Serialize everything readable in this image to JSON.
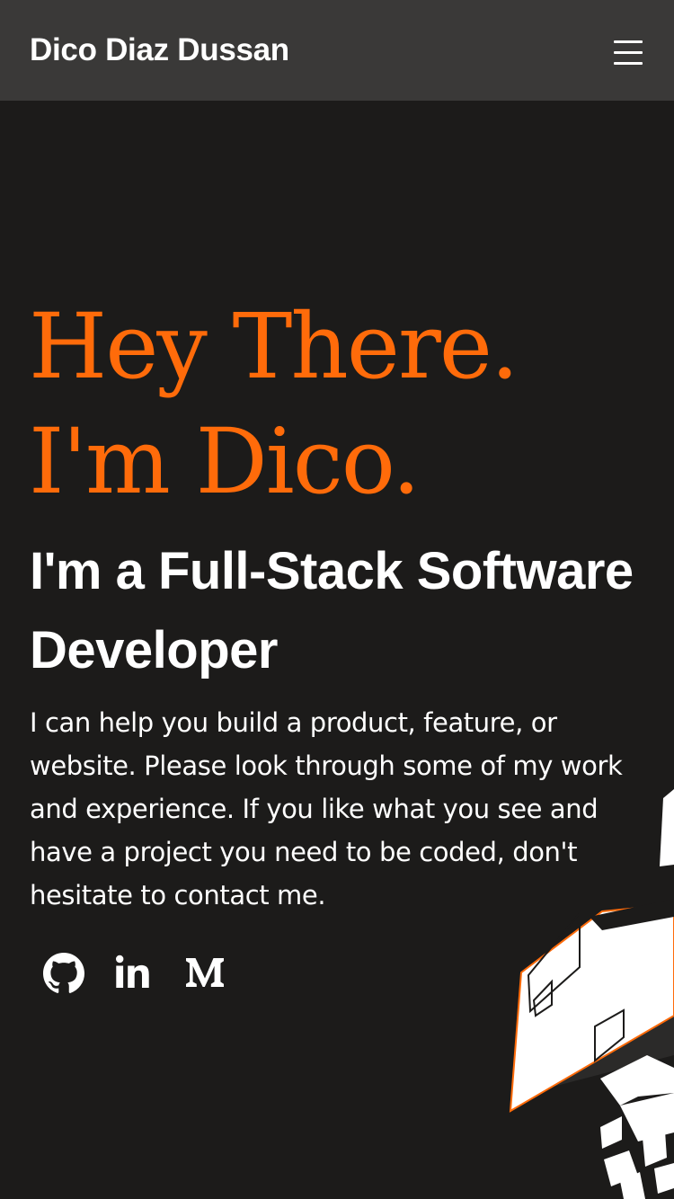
{
  "header": {
    "brand": "Dico Diaz Dussan",
    "menu_icon": "hamburger-menu-icon"
  },
  "hero": {
    "greeting": "Hey There. I'm Dico.",
    "role": "I'm a Full-Stack Software Developer",
    "description": "I can help you build a product, feature, or website. Please look through some of my work and experience. If you like what you see and have a project you need to be coded, don't hesitate to contact me."
  },
  "social": {
    "icons": [
      "github-icon",
      "linkedin-icon",
      "medium-icon"
    ]
  },
  "colors": {
    "accent": "#ff6b0a",
    "background": "#1c1b1a",
    "navbar": "#3a3938",
    "text": "#ffffff"
  }
}
